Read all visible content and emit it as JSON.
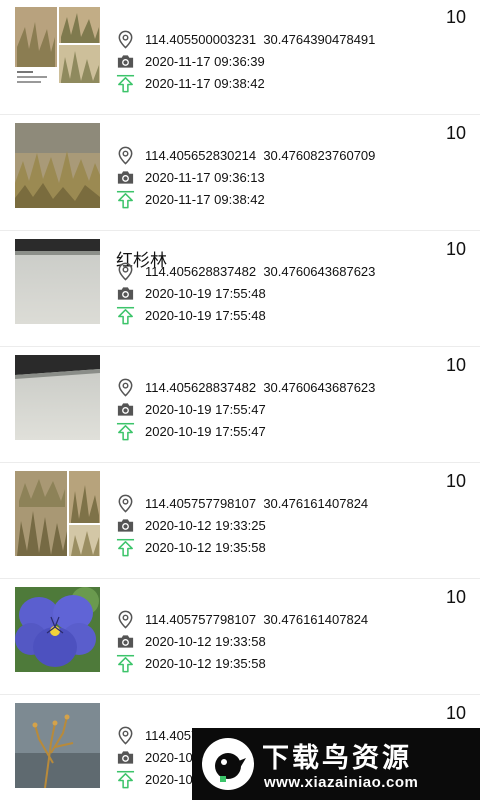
{
  "records": [
    {
      "title": "",
      "count": "10",
      "coords": "114.405500003231  30.4764390478491",
      "captured": "2020-11-17 09:36:39",
      "uploaded": "2020-11-17 09:38:42",
      "thumb": "collage-grass"
    },
    {
      "title": "",
      "count": "10",
      "coords": "114.405652830214  30.4760823760709",
      "captured": "2020-11-17 09:36:13",
      "uploaded": "2020-11-17 09:38:42",
      "thumb": "dry-shrub"
    },
    {
      "title": "红杉林",
      "count": "10",
      "coords": "114.405628837482  30.4760643687623",
      "captured": "2020-10-19 17:55:48",
      "uploaded": "2020-10-19 17:55:48",
      "thumb": "grey-surface"
    },
    {
      "title": "",
      "count": "10",
      "coords": "114.405628837482  30.4760643687623",
      "captured": "2020-10-19 17:55:47",
      "uploaded": "2020-10-19 17:55:47",
      "thumb": "grey-surface"
    },
    {
      "title": "",
      "count": "10",
      "coords": "114.405757798107  30.476161407824",
      "captured": "2020-10-12 19:33:25",
      "uploaded": "2020-10-12 19:35:58",
      "thumb": "collage-field"
    },
    {
      "title": "",
      "count": "10",
      "coords": "114.405757798107  30.476161407824",
      "captured": "2020-10-12 19:33:58",
      "uploaded": "2020-10-12 19:35:58",
      "thumb": "purple-pansy"
    },
    {
      "title": "",
      "count": "10",
      "coords": "114.40575",
      "captured": "2020-10",
      "uploaded": "2020-10",
      "thumb": "plant-stem"
    }
  ],
  "icons": {
    "location": "location-pin-icon",
    "camera": "camera-icon",
    "upload": "upload-arrow-icon"
  },
  "colors": {
    "upload_green": "#3cc46a",
    "icon_grey": "#555555",
    "divider": "#ececec"
  },
  "watermark": {
    "title": "下载鸟资源",
    "url": "www.xiazainiao.com"
  }
}
